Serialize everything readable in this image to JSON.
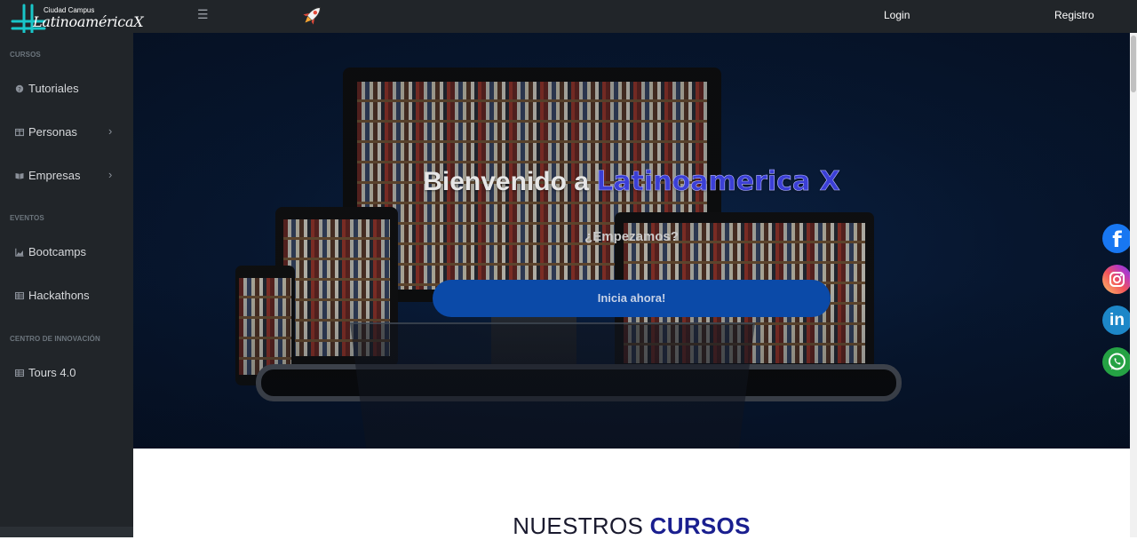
{
  "brand": {
    "small_text": "Ciudad Campus",
    "big_text": "LatinoaméricaX"
  },
  "header": {
    "menu_icon": "hamburger-icon",
    "login_label": "Login",
    "registro_label": "Registro"
  },
  "sidebar": {
    "sections": [
      {
        "heading": "CURSOS"
      },
      {
        "heading": "EVENTOS"
      },
      {
        "heading": "CENTRO DE INNOVACIÓN"
      }
    ],
    "items": [
      {
        "label": "Tutoriales",
        "icon": "help-circle-icon"
      },
      {
        "label": "Personas",
        "icon": "columns-icon",
        "has_submenu": true
      },
      {
        "label": "Empresas",
        "icon": "book-open-icon",
        "has_submenu": true
      },
      {
        "label": "Bootcamps",
        "icon": "chart-area-icon"
      },
      {
        "label": "Hackathons",
        "icon": "table-icon"
      },
      {
        "label": "Tours 4.0",
        "icon": "table-icon"
      }
    ]
  },
  "hero": {
    "title_prefix": "Bienvenido a ",
    "title_accent": "Latinoamerica X",
    "subtitle": "¿Empezamos?",
    "cta_label": "Inicia ahora!"
  },
  "social": [
    {
      "name": "facebook",
      "glyph": "f"
    },
    {
      "name": "instagram"
    },
    {
      "name": "linkedin",
      "glyph": "in"
    },
    {
      "name": "whatsapp"
    }
  ],
  "courses": {
    "title_prefix": "NUESTROS ",
    "title_accent": "CURSOS"
  },
  "colors": {
    "dark_bg": "#212529",
    "accent_blue": "#0b4aa8",
    "title_accent": "#1a1f8f"
  }
}
